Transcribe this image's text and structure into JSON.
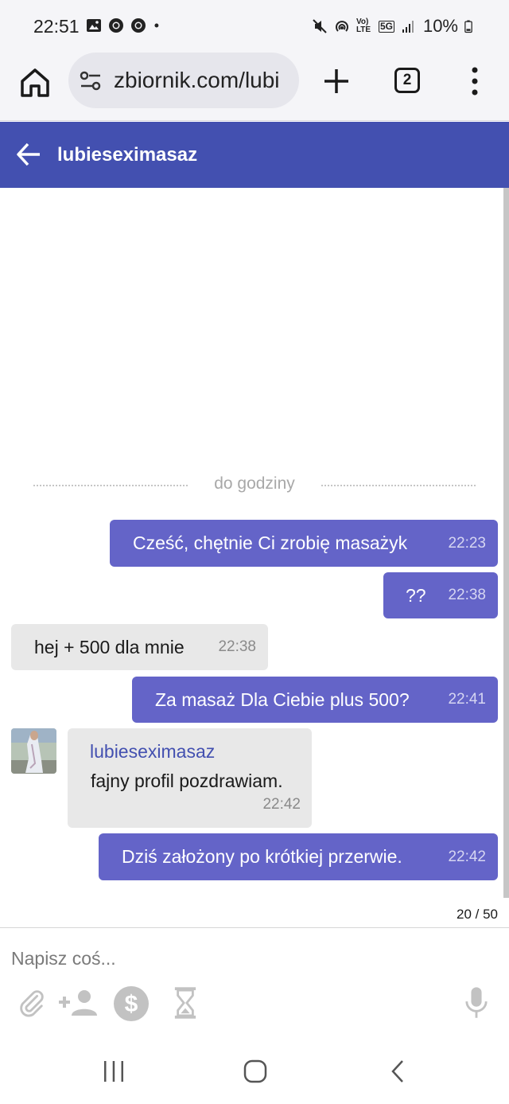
{
  "status_bar": {
    "time": "22:51",
    "battery": "10%",
    "left_icons": [
      "gallery-icon",
      "chrome-icon",
      "chrome-icon",
      "dot-icon"
    ],
    "right_icons": [
      "mute-icon",
      "hotspot-icon",
      "volte-icon",
      "5g-icon",
      "signal-icon",
      "battery-icon"
    ],
    "volte_label": "Vo) LTE",
    "net_label": "5G"
  },
  "browser": {
    "url": "zbiornik.com/lubi",
    "tab_count": "2"
  },
  "header": {
    "title": "lubieseximasaz"
  },
  "chat": {
    "divider": "do godziny",
    "messages": [
      {
        "direction": "out",
        "text": "Cześć, chętnie Ci zrobię masażyk",
        "time": "22:23"
      },
      {
        "direction": "out",
        "text": "??",
        "time": "22:38"
      },
      {
        "direction": "in",
        "text": "hej + 500 dla mnie",
        "time": "22:38"
      },
      {
        "direction": "out",
        "text": "Za masaż Dla Ciebie plus 500?",
        "time": "22:41"
      },
      {
        "direction": "in",
        "sender": "lubieseximasaz",
        "text": "fajny profil pozdrawiam.",
        "time": "22:42"
      },
      {
        "direction": "out",
        "text": "Dziś założony po krótkiej przerwie.",
        "time": "22:42"
      }
    ],
    "counter": "20 / 50"
  },
  "composer": {
    "placeholder": "Napisz coś...",
    "tools": [
      "paperclip-icon",
      "add-person-icon",
      "dollar-icon",
      "hourglass-icon",
      "microphone-icon"
    ]
  },
  "colors": {
    "header_bg": "#4350b0",
    "outgoing_bubble": "#6464c8",
    "incoming_bubble": "#e8e8e8",
    "sender_name": "#4350b0"
  }
}
